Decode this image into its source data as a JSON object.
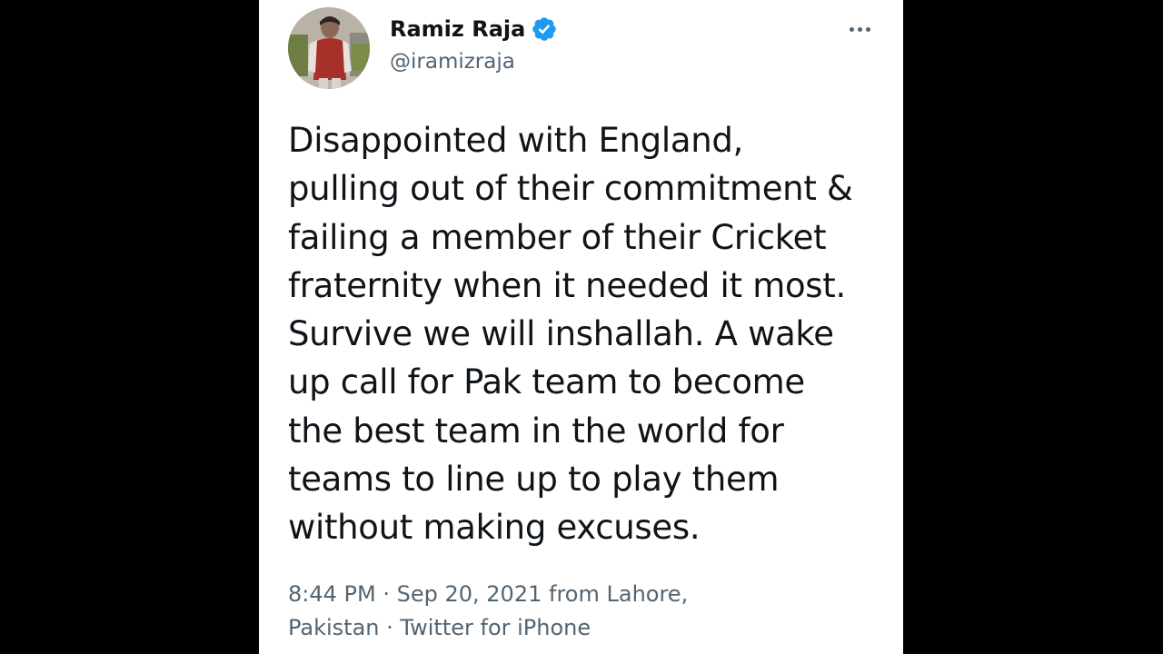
{
  "author": {
    "display_name": "Ramiz Raja",
    "handle": "@iramizraja",
    "verified": true
  },
  "tweet": {
    "lines": [
      "Disappointed with England,",
      "pulling out of their commitment &",
      "failing a member of their Cricket",
      "fraternity when it needed it most.",
      "Survive we will inshallah. A wake",
      "up call for Pak team to become",
      "the best team in the world for",
      "teams to line up to play them",
      "without making excuses."
    ]
  },
  "meta": {
    "time": "8:44 PM",
    "separator": "·",
    "date": "Sep 20, 2021",
    "location_prefix": "from Lahore,",
    "location_rest": "Pakistan",
    "source": "Twitter for iPhone"
  },
  "icons": {
    "verified": "verified-badge-icon",
    "more": "more-horizontal-icon"
  },
  "colors": {
    "text": "#0f1419",
    "secondary": "#536471",
    "verified": "#1d9bf0",
    "background": "#ffffff",
    "letterbox": "#000000"
  }
}
